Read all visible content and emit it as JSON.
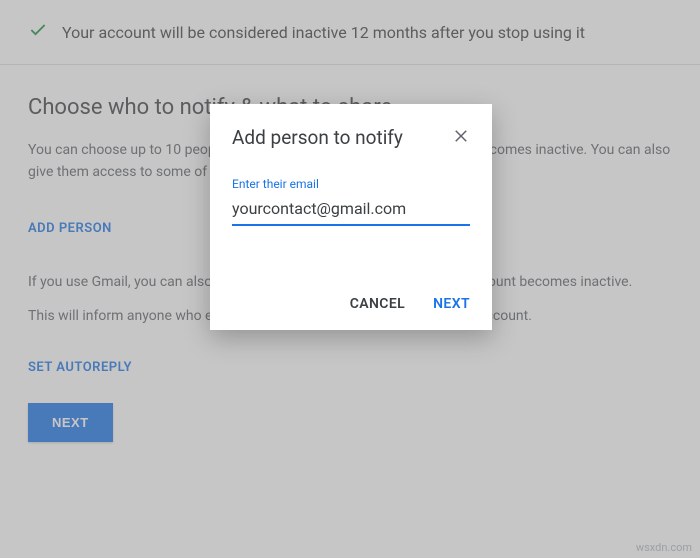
{
  "banner": {
    "text": "Your account will be considered inactive 12 months after you stop using it"
  },
  "section": {
    "title": "Choose who to notify & what to share",
    "para1": "You can choose up to 10 people for Google to notify when your account becomes inactive. You can also give them access to some of your data.",
    "add_person_label": "ADD PERSON",
    "para2": "If you use Gmail, you can also set up an autoreply to be sent after your account becomes inactive.",
    "para3": "This will inform anyone who emails you that you are no longer using this account.",
    "autoreply_label": "SET AUTOREPLY",
    "next_label": "NEXT"
  },
  "dialog": {
    "title": "Add person to notify",
    "field_label": "Enter their email",
    "email_value": "yourcontact@gmail.com",
    "cancel_label": "CANCEL",
    "next_label": "NEXT"
  },
  "watermark": "wsxdn.com"
}
